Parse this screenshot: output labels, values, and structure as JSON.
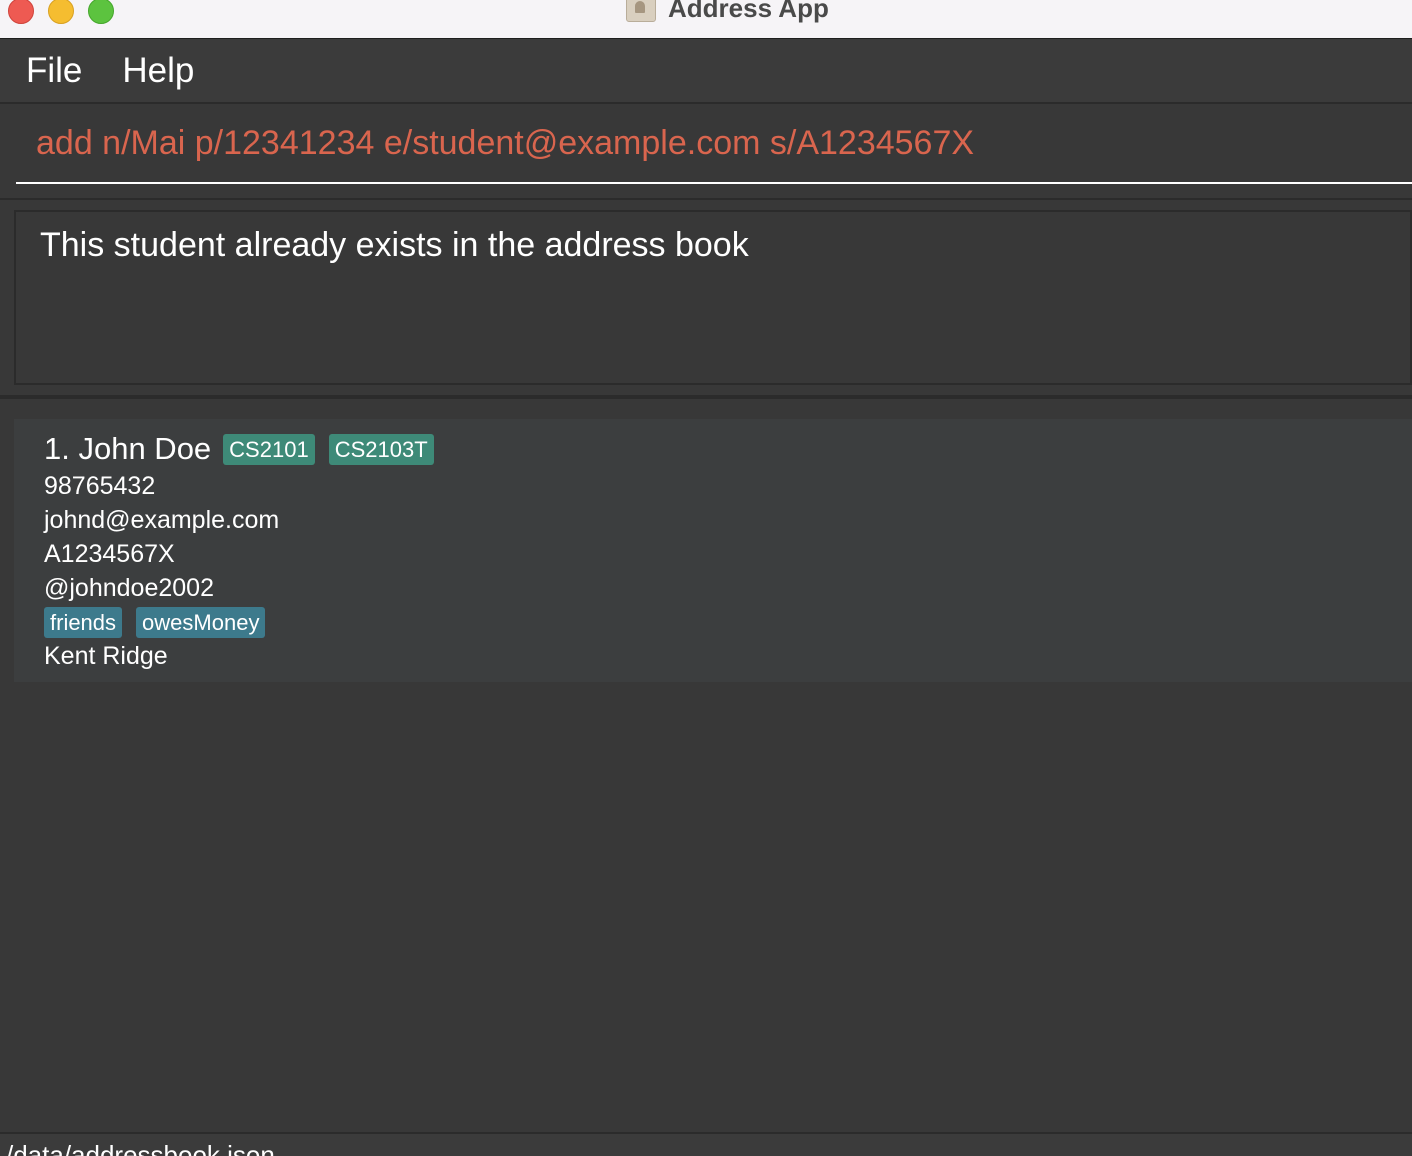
{
  "window": {
    "title": "Address App"
  },
  "menu": {
    "items": [
      "File",
      "Help"
    ]
  },
  "command": {
    "value": "add n/Mai p/12341234 e/student@example.com s/A1234567X"
  },
  "result": {
    "message": "This student already exists in the address book"
  },
  "persons": [
    {
      "name": "1. John Doe",
      "courses": [
        "CS2101",
        "CS2103T"
      ],
      "phone": "98765432",
      "email": "johnd@example.com",
      "student_id": "A1234567X",
      "telegram": "@johndoe2002",
      "tags": [
        "friends",
        "owesMoney"
      ],
      "address": "Kent Ridge"
    }
  ],
  "status": {
    "file_path": "/data/addressbook.json"
  },
  "colors": {
    "background": "#383838",
    "command_text": "#d9654e",
    "course_tag": "#3e8a78",
    "tag": "#3d7a8c"
  },
  "icons": {
    "app": "address-book-icon"
  }
}
